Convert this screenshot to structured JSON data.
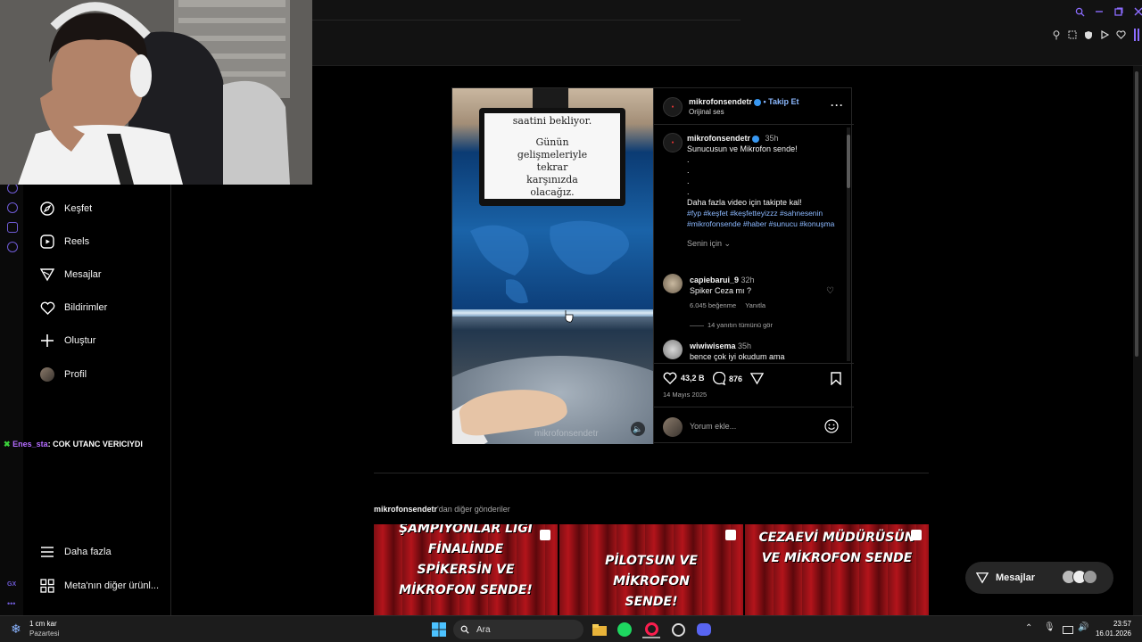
{
  "browser": {
    "right_icons": [
      "search-icon",
      "minimize-icon",
      "restore-icon",
      "close-icon"
    ],
    "toolbar_icons": [
      "pin-icon",
      "snapshot-icon",
      "shield-icon",
      "play-icon",
      "heart-icon"
    ]
  },
  "sidebar": {
    "items": [
      {
        "label": "Keşfet",
        "icon": "compass-icon"
      },
      {
        "label": "Reels",
        "icon": "reels-icon"
      },
      {
        "label": "Mesajlar",
        "icon": "messenger-icon"
      },
      {
        "label": "Bildirimler",
        "icon": "heart-icon"
      },
      {
        "label": "Oluştur",
        "icon": "plus-icon"
      },
      {
        "label": "Profil",
        "icon": "avatar"
      }
    ],
    "bottom_items": [
      {
        "label": "Daha fazla",
        "icon": "menu-icon"
      },
      {
        "label": "Meta'nın diğer ürünl...",
        "icon": "grid-icon"
      }
    ]
  },
  "chat": {
    "user": "Enes_sta",
    "message": ": COK UTANC VERICIYDI"
  },
  "video": {
    "teleprompter_lines": [
      "saatini bekliyor.",
      "",
      "Günün",
      "gelişmeleriyle",
      "tekrar",
      "karşınızda",
      "olacağız."
    ],
    "watermark": "mikrofonsendetr"
  },
  "post": {
    "author": "mikrofonsendetr",
    "follow_label": "• Takip Et",
    "audio": "Orijinal ses",
    "caption_author": "mikrofonsendetr",
    "caption_time": "35h",
    "caption_lines": [
      "Sunucusun ve Mikrofon sende!",
      ".",
      ".",
      ".",
      ".",
      "Daha fazla video için takipte kal!"
    ],
    "hashtags": "#fyp #keşfet #keşfetteyizzz #sahnesenin #mikrofonsende #haber #sunucu #konuşma",
    "for_you": "Senin için",
    "comments": [
      {
        "user": "capiebarui_9",
        "time": "32h",
        "text": "Spiker Ceza mı ?",
        "likes": "6.045 beğenme",
        "reply": "Yanıtla",
        "view_replies": "14 yanıtın tümünü gör"
      },
      {
        "user": "wiwiwisema",
        "time": "35h",
        "text": "bence çok iyi okudum ama"
      }
    ],
    "like_count": "43,2 B",
    "comment_count": "876",
    "date": "14 Mayıs 2025",
    "comment_placeholder": "Yorum ekle..."
  },
  "more_posts": {
    "author": "mikrofonsendetr",
    "suffix": "'dan diğer gönderiler",
    "thumbs": [
      {
        "text": "ŞAMPİYONLAR LİGİ FİNALİNDE SPİKERSİN VE MİKROFON SENDE!"
      },
      {
        "text": "PİLOTSUN VE MİKROFON SENDE!"
      },
      {
        "text": "CEZAEVİ MÜDÜRÜSÜN VE MİKROFON SENDE"
      }
    ]
  },
  "messages_button": {
    "label": "Mesajlar"
  },
  "taskbar": {
    "weather_temp": "1 cm kar",
    "weather_day": "Pazartesi",
    "search_label": "Ara",
    "time": "23:57",
    "date": "16.01.2026"
  },
  "colors": {
    "accent": "#8cb9ff",
    "gx_purple": "#6f5bd6",
    "chat_user": "#b46cff"
  }
}
